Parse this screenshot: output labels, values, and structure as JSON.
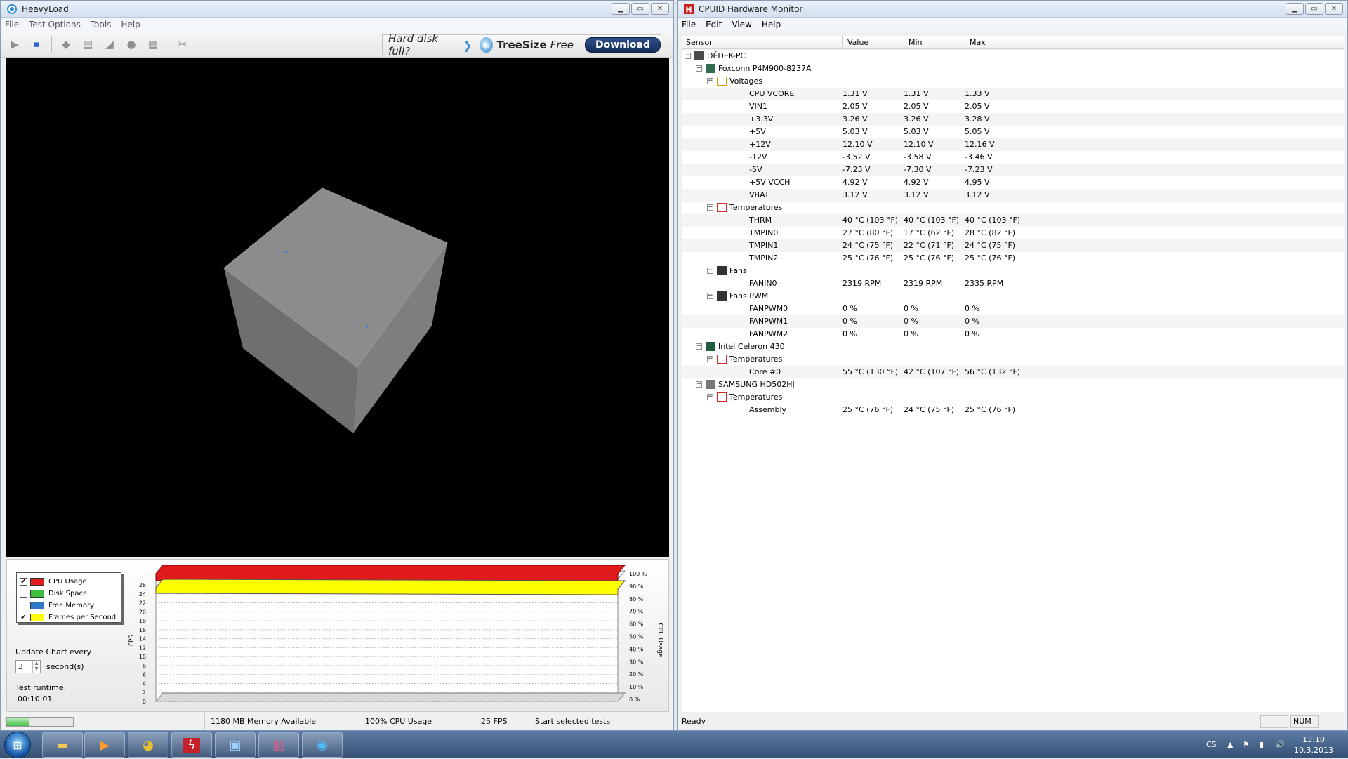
{
  "heavyload": {
    "title": "HeavyLoad",
    "menu": [
      "File",
      "Test Options",
      "Tools",
      "Help"
    ],
    "ad": {
      "question": "Hard disk full?",
      "brand": "TreeSize",
      "brand_suffix": "Free",
      "download": "Download"
    },
    "legend": [
      {
        "label": "CPU Usage",
        "checked": true,
        "color": "#e11b1b"
      },
      {
        "label": "Disk Space",
        "checked": false,
        "color": "#3cbf3c"
      },
      {
        "label": "Free Memory",
        "checked": false,
        "color": "#2f78c8"
      },
      {
        "label": "Frames per Second",
        "checked": true,
        "color": "#ffff00"
      }
    ],
    "update_label": "Update Chart every",
    "update_value": "3",
    "update_unit": "second(s)",
    "runtime_label": "Test runtime:",
    "runtime_value": "00:10:01",
    "chart": {
      "fps_ticks": [
        "26",
        "24",
        "22",
        "20",
        "18",
        "16",
        "14",
        "12",
        "10",
        "8",
        "6",
        "4",
        "2",
        "0"
      ],
      "cpu_ticks": [
        "100 %",
        "90 %",
        "80 %",
        "70 %",
        "60 %",
        "50 %",
        "40 %",
        "30 %",
        "20 %",
        "10 %",
        "0 %"
      ],
      "left_axis_label": "FPS",
      "right_axis_label": "CPU Usage"
    },
    "status": {
      "memory": "1180 MB Memory Available",
      "cpu": "100% CPU Usage",
      "fps": "25 FPS",
      "action": "Start selected tests",
      "progress": 0.33
    }
  },
  "hwmon": {
    "title": "CPUID Hardware Monitor",
    "menu": [
      "File",
      "Edit",
      "View",
      "Help"
    ],
    "columns": [
      "Sensor",
      "Value",
      "Min",
      "Max"
    ],
    "rows": [
      {
        "level": 0,
        "label": "DĚDEK-PC",
        "icon": "computer-icon",
        "toggle": "−"
      },
      {
        "level": 1,
        "label": "Foxconn P4M900-8237A",
        "icon": "motherboard-icon",
        "toggle": "−"
      },
      {
        "level": 2,
        "label": "Voltages",
        "icon": "voltage-icon",
        "toggle": "−"
      },
      {
        "level": 3,
        "label": "CPU VCORE",
        "value": "1.31 V",
        "min": "1.31 V",
        "max": "1.33 V"
      },
      {
        "level": 3,
        "label": "VIN1",
        "value": "2.05 V",
        "min": "2.05 V",
        "max": "2.05 V"
      },
      {
        "level": 3,
        "label": "+3.3V",
        "value": "3.26 V",
        "min": "3.26 V",
        "max": "3.28 V"
      },
      {
        "level": 3,
        "label": "+5V",
        "value": "5.03 V",
        "min": "5.03 V",
        "max": "5.05 V"
      },
      {
        "level": 3,
        "label": "+12V",
        "value": "12.10 V",
        "min": "12.10 V",
        "max": "12.16 V"
      },
      {
        "level": 3,
        "label": "-12V",
        "value": "-3.52 V",
        "min": "-3.58 V",
        "max": "-3.46 V"
      },
      {
        "level": 3,
        "label": "-5V",
        "value": "-7.23 V",
        "min": "-7.30 V",
        "max": "-7.23 V"
      },
      {
        "level": 3,
        "label": "+5V VCCH",
        "value": "4.92 V",
        "min": "4.92 V",
        "max": "4.95 V"
      },
      {
        "level": 3,
        "label": "VBAT",
        "value": "3.12 V",
        "min": "3.12 V",
        "max": "3.12 V"
      },
      {
        "level": 2,
        "label": "Temperatures",
        "icon": "thermometer-icon",
        "toggle": "−"
      },
      {
        "level": 3,
        "label": "THRM",
        "value": "40 °C  (103 °F)",
        "min": "40 °C  (103 °F)",
        "max": "40 °C  (103 °F)"
      },
      {
        "level": 3,
        "label": "TMPIN0",
        "value": "27 °C  (80 °F)",
        "min": "17 °C  (62 °F)",
        "max": "28 °C  (82 °F)"
      },
      {
        "level": 3,
        "label": "TMPIN1",
        "value": "24 °C  (75 °F)",
        "min": "22 °C  (71 °F)",
        "max": "24 °C  (75 °F)"
      },
      {
        "level": 3,
        "label": "TMPIN2",
        "value": "25 °C  (76 °F)",
        "min": "25 °C  (76 °F)",
        "max": "25 °C  (76 °F)"
      },
      {
        "level": 2,
        "label": "Fans",
        "icon": "fan-icon",
        "toggle": "−"
      },
      {
        "level": 3,
        "label": "FANIN0",
        "value": "2319 RPM",
        "min": "2319 RPM",
        "max": "2335 RPM"
      },
      {
        "level": 2,
        "label": "Fans PWM",
        "icon": "fan-icon",
        "toggle": "−"
      },
      {
        "level": 3,
        "label": "FANPWM0",
        "value": "0 %",
        "min": "0 %",
        "max": "0 %"
      },
      {
        "level": 3,
        "label": "FANPWM1",
        "value": "0 %",
        "min": "0 %",
        "max": "0 %"
      },
      {
        "level": 3,
        "label": "FANPWM2",
        "value": "0 %",
        "min": "0 %",
        "max": "0 %"
      },
      {
        "level": 1,
        "label": "Intel Celeron 430",
        "icon": "cpu-chip-icon",
        "toggle": "−"
      },
      {
        "level": 2,
        "label": "Temperatures",
        "icon": "thermometer-icon",
        "toggle": "−"
      },
      {
        "level": 3,
        "label": "Core #0",
        "value": "55 °C  (130 °F)",
        "min": "42 °C  (107 °F)",
        "max": "56 °C  (132 °F)"
      },
      {
        "level": 1,
        "label": "SAMSUNG HD502HJ",
        "icon": "hard-disk-icon",
        "toggle": "−"
      },
      {
        "level": 2,
        "label": "Temperatures",
        "icon": "thermometer-icon",
        "toggle": "−"
      },
      {
        "level": 3,
        "label": "Assembly",
        "value": "25 °C  (76 °F)",
        "min": "24 °C  (75 °F)",
        "max": "25 °C  (76 °F)"
      }
    ],
    "status": {
      "ready": "Ready",
      "num": "NUM"
    }
  },
  "taskbar": {
    "lang": "CS",
    "time": "13:10",
    "date": "10.3.2013",
    "apps": [
      "explorer-icon",
      "media-player-icon",
      "chrome-icon",
      "flash-icon",
      "control-panel-icon",
      "winrar-icon",
      "heavyload-icon"
    ]
  }
}
